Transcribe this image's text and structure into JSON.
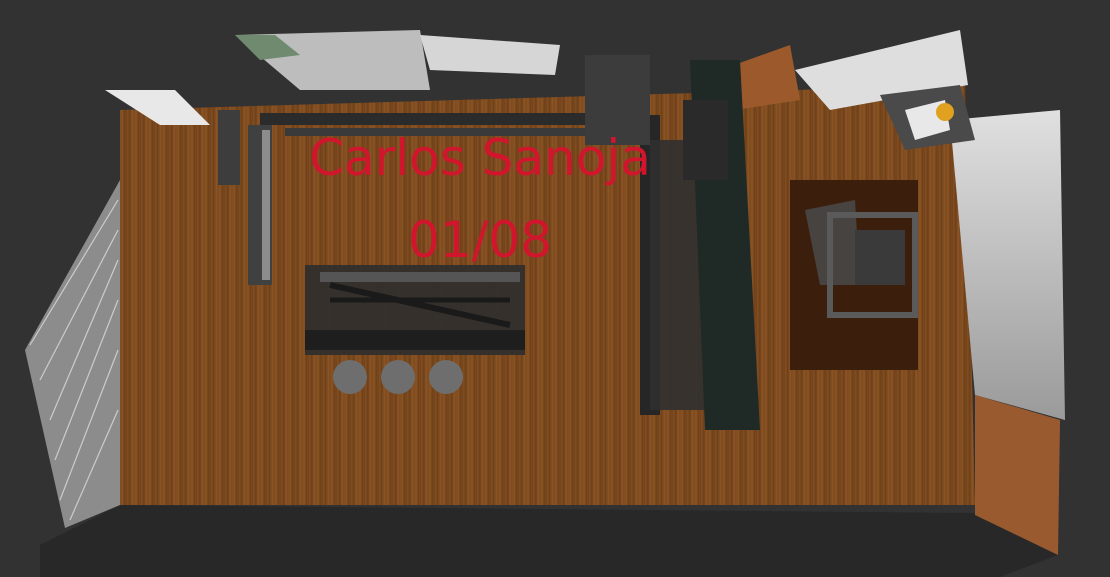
{
  "viewer": {
    "background_color": "#323232",
    "overlay_color": "#d0152c"
  },
  "overlay": {
    "name": "Carlos Sanoja",
    "date": "01/08"
  },
  "scene": {
    "floor_color": "#7a4a1e",
    "wall_color": "#c8c8c8"
  }
}
